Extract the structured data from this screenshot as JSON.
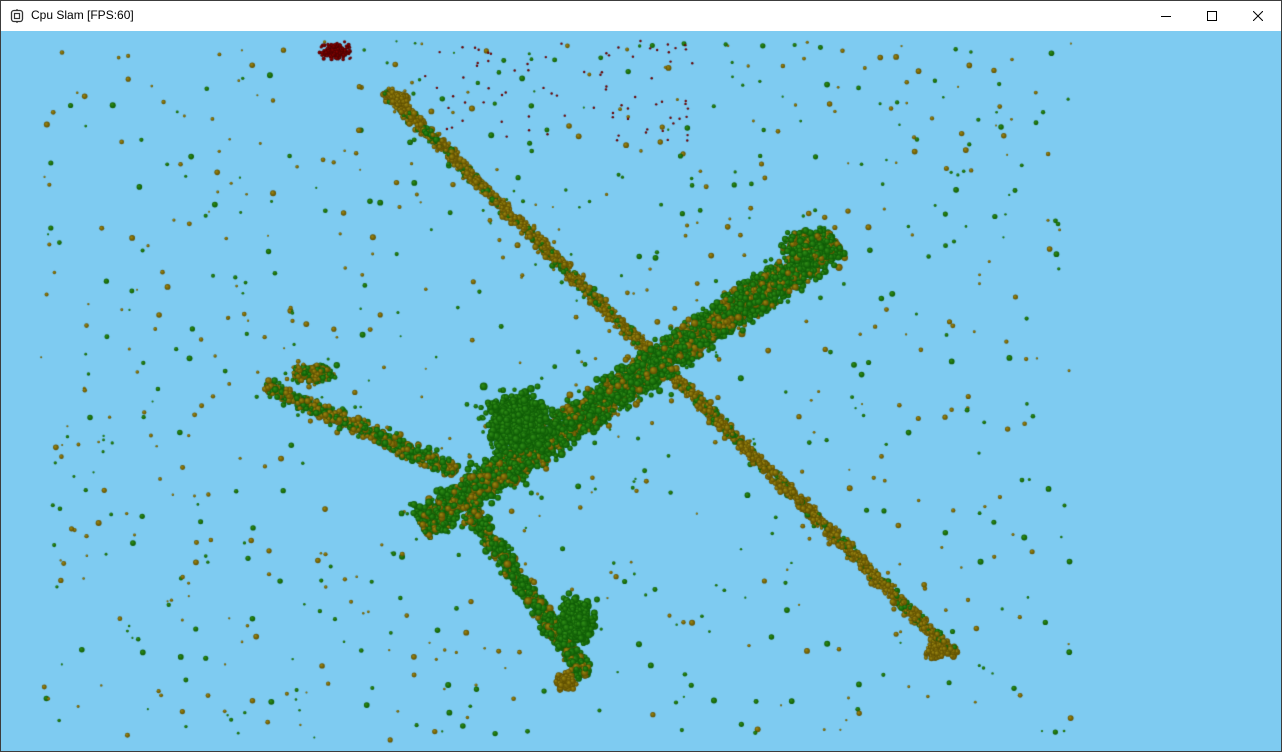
{
  "window": {
    "title": "Cpu Slam [FPS:60]",
    "controls": {
      "minimize_icon": "minimize-icon",
      "maximize_icon": "maximize-icon",
      "close_icon": "close-icon"
    }
  },
  "scene": {
    "background_color": "#7ecbf1",
    "colors": {
      "green": "#2e8b16",
      "green_dark": "#0d5a05",
      "olive": "#9a8510",
      "olive_dark": "#5e4e00",
      "red": "#8b0000"
    }
  }
}
